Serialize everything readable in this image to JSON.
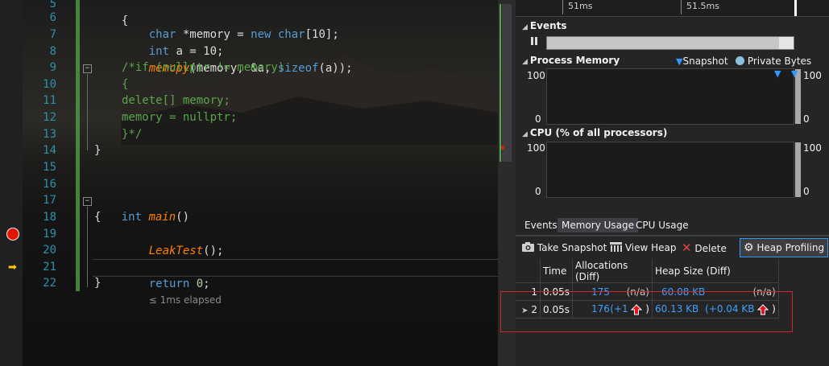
{
  "editor": {
    "line_numbers": [
      "5",
      "6",
      "7",
      "8",
      "9",
      "10",
      "11",
      "12",
      "13",
      "14",
      "15",
      "16",
      "17",
      "18",
      "19",
      "20",
      "21",
      "22"
    ],
    "lines": {
      "l5": "{",
      "l6_type": "char",
      "l6_rest": " *memory = ",
      "l6_new": "new",
      "l6_type2": " char",
      "l6_tail": "[10];",
      "l7_type": "int",
      "l7_rest": " a = 10;",
      "l8_fn": "memcpy",
      "l8_rest": "(memory, &a, ",
      "l8_sizeof": "sizeof",
      "l8_tail": "(a));",
      "l9": "/*if (nullptr != memory)",
      "l10": "{",
      "l11": "delete[] memory;",
      "l12": "memory = nullptr;",
      "l13": "}*/",
      "l14": "}",
      "l17_type": "int",
      "l17_fn": "main",
      "l17_tail": "()",
      "l18": "{",
      "l19_fn": "LeakTest",
      "l19_tail": "();",
      "l21_kw": "return",
      "l21_num": " 0",
      "l21_tail": ";",
      "l21_elapsed": "≤ 1ms elapsed",
      "l22": "}"
    },
    "fold_glyph": "−"
  },
  "diagnostics": {
    "ruler": {
      "tick1": "51ms",
      "tick2": "51.5ms"
    },
    "events_label": "Events",
    "process_memory": {
      "label": "Process Memory",
      "snapshot_legend": "Snapshot",
      "private_bytes_legend": "Private Bytes",
      "y_max_left": "100",
      "y_min_left": "0",
      "y_max_right": "100",
      "y_min_right": "0"
    },
    "cpu": {
      "label": "CPU (% of all processors)",
      "y_max_left": "100",
      "y_min_left": "0",
      "y_max_right": "100",
      "y_min_right": "0"
    },
    "tabs": [
      "Events",
      "Memory Usage",
      "CPU Usage"
    ],
    "toolbar": {
      "take_snapshot": "Take Snapshot",
      "view_heap": "View Heap",
      "delete": "Delete",
      "heap_profiling": "Heap Profiling"
    },
    "table": {
      "headers": [
        "Time",
        "Allocations (Diff)",
        "Heap Size (Diff)"
      ],
      "rows": [
        {
          "id": "1",
          "time": "0.05s",
          "alloc": "175",
          "alloc_diff": "(n/a)",
          "heap": "60.08 KB",
          "heap_diff": "(n/a)"
        },
        {
          "id": "2",
          "time": "0.05s",
          "alloc": "176",
          "alloc_diff_pre": "(+1",
          "alloc_diff_post": ")",
          "heap": "60.13 KB",
          "heap_diff_pre": "(+0.04 KB",
          "heap_diff_post": ")"
        }
      ]
    },
    "colors": {
      "accent": "#3ea0ff",
      "highlight": "#d0252a",
      "breakpoint": "#e51400"
    }
  }
}
